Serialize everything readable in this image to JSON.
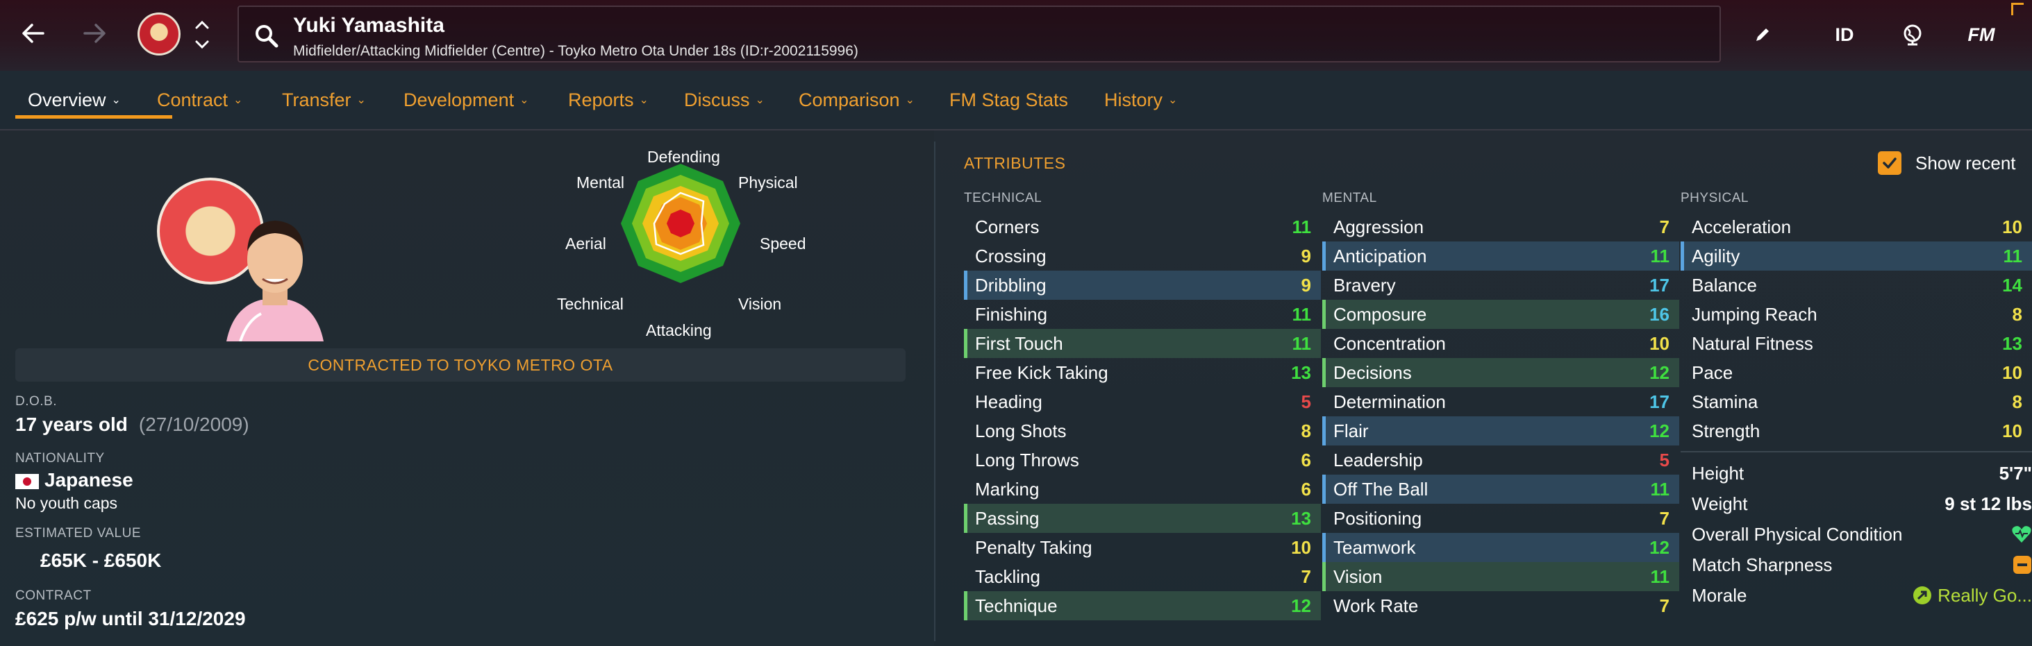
{
  "header": {
    "player_name": "Yuki Yamashita",
    "subtitle": "Midfielder/Attacking Midfielder (Centre) - Toyko Metro Ota Under 18s (ID:r-2002115996)",
    "id_label": "ID",
    "fm_label": "FM"
  },
  "tabs": [
    {
      "label": "Overview",
      "chevron": true
    },
    {
      "label": "Contract",
      "chevron": true
    },
    {
      "label": "Transfer",
      "chevron": true
    },
    {
      "label": "Development",
      "chevron": true
    },
    {
      "label": "Reports",
      "chevron": true
    },
    {
      "label": "Discuss",
      "chevron": true
    },
    {
      "label": "Comparison",
      "chevron": true
    },
    {
      "label": "FM Stag Stats",
      "chevron": false
    },
    {
      "label": "History",
      "chevron": true
    }
  ],
  "radar": {
    "labels": {
      "defending": "Defending",
      "physical": "Physical",
      "speed": "Speed",
      "vision": "Vision",
      "attacking": "Attacking",
      "technical": "Technical",
      "aerial": "Aerial",
      "mental": "Mental"
    }
  },
  "profile": {
    "contract_banner": "CONTRACTED TO TOYKO METRO OTA",
    "dob_label": "D.O.B.",
    "age": "17 years old",
    "dob": "(27/10/2009)",
    "nationality_label": "NATIONALITY",
    "nationality": "Japanese",
    "youth_caps": "No youth caps",
    "value_label": "ESTIMATED VALUE",
    "value": "£65K - £650K",
    "contract_label": "CONTRACT",
    "contract": "£625 p/w until 31/12/2029"
  },
  "attributes": {
    "title": "ATTRIBUTES",
    "show_recent": "Show recent",
    "colors": {
      "high": "#3fe03f",
      "mid": "#f2e14a",
      "low": "#e84a4a",
      "top": "#4ec6e8"
    },
    "technical": {
      "heading": "TECHNICAL",
      "rows": [
        {
          "name": "Corners",
          "value": "11",
          "hl": ""
        },
        {
          "name": "Crossing",
          "value": "9",
          "hl": ""
        },
        {
          "name": "Dribbling",
          "value": "9",
          "hl": "blue"
        },
        {
          "name": "Finishing",
          "value": "11",
          "hl": ""
        },
        {
          "name": "First Touch",
          "value": "11",
          "hl": "green"
        },
        {
          "name": "Free Kick Taking",
          "value": "13",
          "hl": ""
        },
        {
          "name": "Heading",
          "value": "5",
          "hl": ""
        },
        {
          "name": "Long Shots",
          "value": "8",
          "hl": ""
        },
        {
          "name": "Long Throws",
          "value": "6",
          "hl": ""
        },
        {
          "name": "Marking",
          "value": "6",
          "hl": ""
        },
        {
          "name": "Passing",
          "value": "13",
          "hl": "green"
        },
        {
          "name": "Penalty Taking",
          "value": "10",
          "hl": ""
        },
        {
          "name": "Tackling",
          "value": "7",
          "hl": ""
        },
        {
          "name": "Technique",
          "value": "12",
          "hl": "green"
        }
      ]
    },
    "mental": {
      "heading": "MENTAL",
      "rows": [
        {
          "name": "Aggression",
          "value": "7",
          "hl": ""
        },
        {
          "name": "Anticipation",
          "value": "11",
          "hl": "blue"
        },
        {
          "name": "Bravery",
          "value": "17",
          "hl": ""
        },
        {
          "name": "Composure",
          "value": "16",
          "hl": "green"
        },
        {
          "name": "Concentration",
          "value": "10",
          "hl": ""
        },
        {
          "name": "Decisions",
          "value": "12",
          "hl": "green"
        },
        {
          "name": "Determination",
          "value": "17",
          "hl": ""
        },
        {
          "name": "Flair",
          "value": "12",
          "hl": "blue"
        },
        {
          "name": "Leadership",
          "value": "5",
          "hl": ""
        },
        {
          "name": "Off The Ball",
          "value": "11",
          "hl": "blue"
        },
        {
          "name": "Positioning",
          "value": "7",
          "hl": ""
        },
        {
          "name": "Teamwork",
          "value": "12",
          "hl": "blue"
        },
        {
          "name": "Vision",
          "value": "11",
          "hl": "green"
        },
        {
          "name": "Work Rate",
          "value": "7",
          "hl": ""
        }
      ]
    },
    "physical": {
      "heading": "PHYSICAL",
      "rows": [
        {
          "name": "Acceleration",
          "value": "10",
          "hl": ""
        },
        {
          "name": "Agility",
          "value": "11",
          "hl": "blue"
        },
        {
          "name": "Balance",
          "value": "14",
          "hl": ""
        },
        {
          "name": "Jumping Reach",
          "value": "8",
          "hl": ""
        },
        {
          "name": "Natural Fitness",
          "value": "13",
          "hl": ""
        },
        {
          "name": "Pace",
          "value": "10",
          "hl": ""
        },
        {
          "name": "Stamina",
          "value": "8",
          "hl": ""
        },
        {
          "name": "Strength",
          "value": "10",
          "hl": ""
        }
      ],
      "height_label": "Height",
      "height": "5'7\"",
      "weight_label": "Weight",
      "weight": "9 st 12 lbs",
      "condition_label": "Overall Physical Condition",
      "condition_icon": "heart-icon",
      "sharpness_label": "Match Sharpness",
      "sharpness_icon": "minus-badge-icon",
      "morale_label": "Morale",
      "morale": "Really Go..."
    }
  }
}
